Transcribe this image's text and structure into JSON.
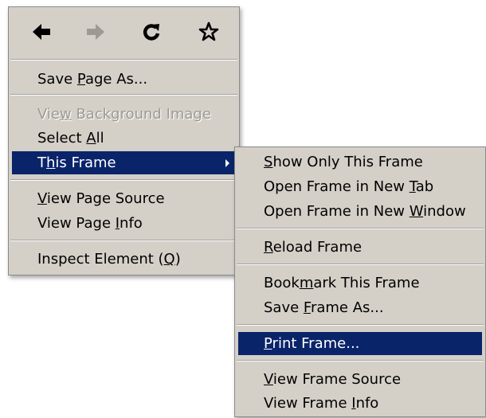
{
  "nav": {
    "back_icon": "arrow-left-icon",
    "forward_icon": "arrow-right-icon",
    "reload_icon": "reload-icon",
    "bookmark_icon": "star-icon"
  },
  "main_menu": {
    "save_page_as": [
      "Save ",
      "P",
      "age As..."
    ],
    "view_background_image": [
      "Vie",
      "w",
      " Background Image"
    ],
    "select_all": [
      "Select ",
      "A",
      "ll"
    ],
    "this_frame": [
      "T",
      "h",
      "is Frame"
    ],
    "view_page_source": [
      "",
      "V",
      "iew Page Source"
    ],
    "view_page_info": [
      "View Page ",
      "I",
      "nfo"
    ],
    "inspect_element": [
      "Inspect Element (",
      "Q",
      ")"
    ]
  },
  "frame_menu": {
    "show_only_this_frame": [
      "",
      "S",
      "how Only This Frame"
    ],
    "open_frame_new_tab": [
      "Open Frame in New ",
      "T",
      "ab"
    ],
    "open_frame_new_window": [
      "Open Frame in New ",
      "W",
      "indow"
    ],
    "reload_frame": [
      "",
      "R",
      "eload Frame"
    ],
    "bookmark_this_frame": [
      "Book",
      "m",
      "ark This Frame"
    ],
    "save_frame_as": [
      "Save ",
      "F",
      "rame As..."
    ],
    "print_frame": [
      "",
      "P",
      "rint Frame..."
    ],
    "view_frame_source": [
      "",
      "V",
      "iew Frame Source"
    ],
    "view_frame_info": [
      "View Frame ",
      "I",
      "nfo"
    ]
  },
  "colors": {
    "menu_bg": "#d4d0c8",
    "highlight_bg": "#0a246a",
    "disabled_text": "#9c9a94"
  }
}
